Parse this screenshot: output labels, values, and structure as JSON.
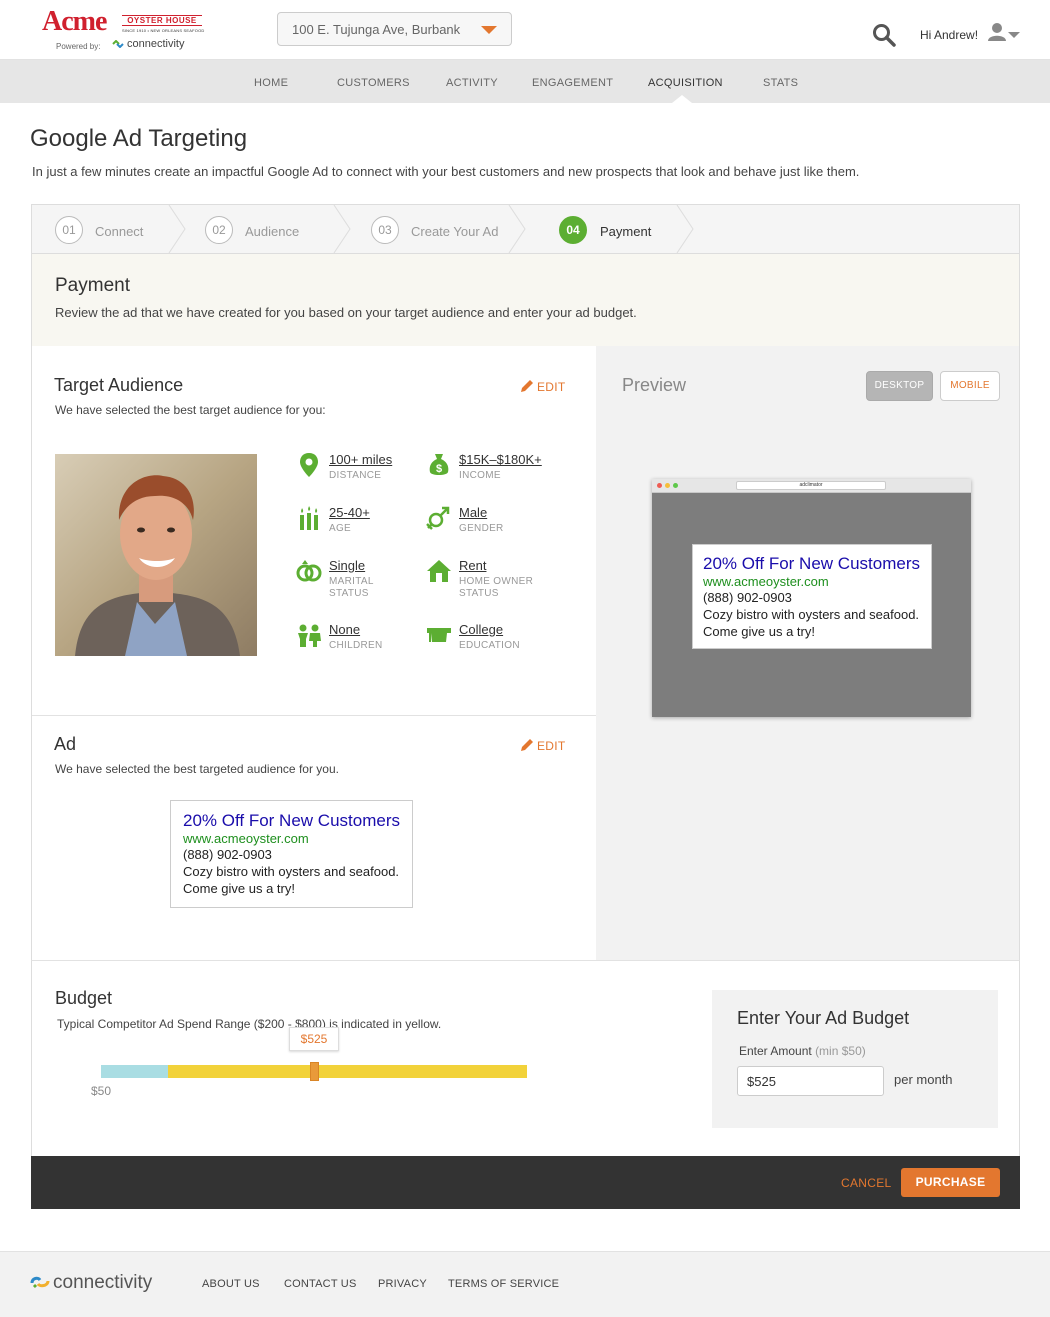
{
  "brand": {
    "name": "Acme",
    "tagline": "OYSTER HOUSE",
    "sub": "SINCE 1910 • NEW ORLEANS SEAFOOD",
    "powered_by": "Powered by:",
    "partner": "connectivity"
  },
  "header": {
    "location_value": "100 E. Tujunga Ave, Burbank",
    "greeting": "Hi Andrew!"
  },
  "nav": {
    "items": [
      "HOME",
      "CUSTOMERS",
      "ACTIVITY",
      "ENGAGEMENT",
      "ACQUISITION",
      "STATS"
    ],
    "active": "ACQUISITION"
  },
  "page": {
    "title": "Google Ad Targeting",
    "description": "In just a few minutes create an impactful Google Ad to connect with your best customers and new prospects that look and behave just like them."
  },
  "steps": [
    {
      "num": "01",
      "label": "Connect"
    },
    {
      "num": "02",
      "label": "Audience"
    },
    {
      "num": "03",
      "label": "Create Your Ad"
    },
    {
      "num": "04",
      "label": "Payment",
      "active": true
    }
  ],
  "payment": {
    "title": "Payment",
    "description": "Review the ad that we have created for you based on your target audience and enter your ad budget."
  },
  "target": {
    "title": "Target Audience",
    "edit": "EDIT",
    "description": "We have selected the best target audience for you:",
    "attributes": {
      "distance": {
        "value": "100+ miles",
        "label": "DISTANCE",
        "icon": "location-pin-icon"
      },
      "income": {
        "value": "$15K–$180K+",
        "label": "INCOME",
        "icon": "money-bag-icon"
      },
      "age": {
        "value": "25-40+",
        "label": "AGE",
        "icon": "age-candles-icon"
      },
      "gender": {
        "value": "Male",
        "label": "GENDER",
        "icon": "gender-icon"
      },
      "marital": {
        "value": "Single",
        "label": "MARITAL STATUS",
        "icon": "rings-icon"
      },
      "home": {
        "value": "Rent",
        "label": "HOME OWNER STATUS",
        "icon": "house-icon"
      },
      "children": {
        "value": "None",
        "label": "CHILDREN",
        "icon": "children-icon"
      },
      "education": {
        "value": "College",
        "label": "EDUCATION",
        "icon": "graduation-cap-icon"
      }
    }
  },
  "ad": {
    "title": "Ad",
    "edit": "EDIT",
    "description": "We have selected the best targeted audience for you.",
    "headline": "20% Off For New Customers",
    "url": "www.acmeoyster.com",
    "phone": "(888) 902-0903",
    "body": "Cozy bistro with oysters and seafood. Come give us a try!"
  },
  "preview": {
    "title": "Preview",
    "desktop": "DESKTOP",
    "mobile": "MOBILE",
    "browser_address": "adclimator"
  },
  "budget": {
    "title": "Budget",
    "description": "Typical Competitor Ad Spend Range  ($200 - $800) is indicated in yellow.",
    "slider": {
      "min": 50,
      "max": 1000,
      "range_low": 200,
      "range_high": 1000,
      "value": 525
    },
    "value_label": "$525",
    "min_label": "$50",
    "enter_title": "Enter Your Ad Budget",
    "enter_label": "Enter Amount",
    "enter_min": "(min $50)",
    "input_value": "$525",
    "per_month": "per month"
  },
  "actions": {
    "cancel": "CANCEL",
    "purchase": "PURCHASE"
  },
  "footer": {
    "logo": "connectivity",
    "links": [
      "ABOUT US",
      "CONTACT US",
      "PRIVACY",
      "TERMS OF SERVICE"
    ]
  },
  "colors": {
    "accent": "#e3772f",
    "green": "#5cae32",
    "blue_bar": "#a9dde3",
    "yellow_bar": "#f2d23a"
  }
}
